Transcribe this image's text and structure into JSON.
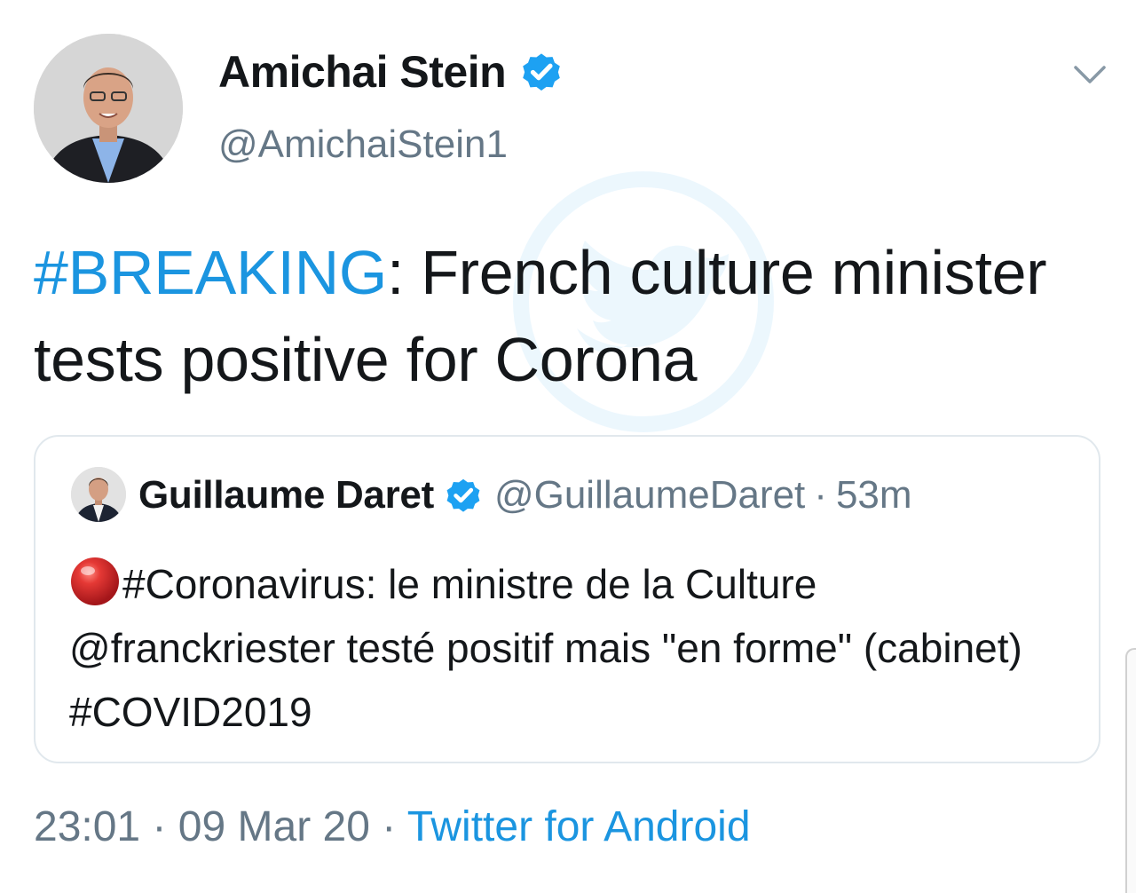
{
  "author": {
    "name": "Amichai Stein",
    "handle": "@AmichaiStein1",
    "verified": true
  },
  "tweet": {
    "hashtag": "#BREAKING",
    "text_after_hashtag": ": French culture minister tests positive for Corona"
  },
  "quoted_tweet": {
    "author_name": "Guillaume Daret",
    "author_handle": "@GuillaumeDaret",
    "separator": "·",
    "time_ago": "53m",
    "emoji_icon": "red-circle",
    "text_part1": "#Coronavirus: le ministre de la Culture",
    "mention": "@franckriester",
    "text_part2": " testé positif mais \"en forme\" (cabinet) ",
    "hashtag": "#COVID2019"
  },
  "meta": {
    "time": "23:01",
    "separator1": " · ",
    "date": "09 Mar 20",
    "separator2": " · ",
    "source": "Twitter for Android"
  },
  "colors": {
    "link": "#1b95e0",
    "secondary_text": "#657786",
    "verified_badge": "#1da1f2",
    "border": "#e1e8ed"
  },
  "icons": {
    "verified": "verified-badge-icon",
    "caret": "chevron-down-icon"
  }
}
